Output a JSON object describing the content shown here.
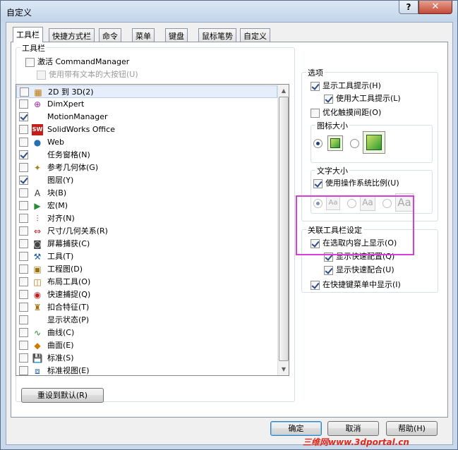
{
  "window": {
    "title": "自定义",
    "help_label": "?",
    "close_label": "✕"
  },
  "tabs": [
    {
      "label": "工具栏",
      "active": true
    },
    {
      "label": "快捷方式栏"
    },
    {
      "label": "命令"
    },
    {
      "label": "菜单"
    },
    {
      "label": "键盘"
    },
    {
      "label": "鼠标笔势"
    },
    {
      "label": "自定义"
    }
  ],
  "toolbars": {
    "group_title": "工具栏",
    "activate_cm": {
      "label": "激活 CommandManager",
      "checked": false
    },
    "use_large_text": {
      "label": "使用带有文本的大按钮(U)",
      "checked": false,
      "disabled": true
    },
    "items": [
      {
        "label": "2D 到 3D(2)",
        "checked": false,
        "icon": "2d-to-3d-icon",
        "glyph": "▦",
        "color": "#c07a00"
      },
      {
        "label": "DimXpert",
        "checked": false,
        "icon": "dimxpert-icon",
        "glyph": "⊕",
        "color": "#9b2aa0"
      },
      {
        "label": "MotionManager",
        "checked": true,
        "icon": "motionmanager-icon",
        "glyph": "",
        "color": "#000"
      },
      {
        "label": "SolidWorks Office",
        "checked": false,
        "icon": "solidworks-office-icon",
        "glyph": "SW",
        "color": "#c3201a"
      },
      {
        "label": "Web",
        "checked": false,
        "icon": "globe-icon",
        "glyph": "●",
        "color": "#2a6fb5"
      },
      {
        "label": "任务窗格(N)",
        "checked": true,
        "icon": "task-pane-icon",
        "glyph": "",
        "color": "#000"
      },
      {
        "label": "参考几何体(G)",
        "checked": false,
        "icon": "reference-geometry-icon",
        "glyph": "✦",
        "color": "#9a8a20"
      },
      {
        "label": "图层(Y)",
        "checked": true,
        "icon": "layers-icon",
        "glyph": "",
        "color": "#000"
      },
      {
        "label": "块(B)",
        "checked": false,
        "icon": "block-icon",
        "glyph": "A",
        "color": "#333"
      },
      {
        "label": "宏(M)",
        "checked": false,
        "icon": "macro-icon",
        "glyph": "▶",
        "color": "#2a8a3a"
      },
      {
        "label": "对齐(N)",
        "checked": false,
        "icon": "align-icon",
        "glyph": "⫶",
        "color": "#b02020"
      },
      {
        "label": "尺寸/几何关系(R)",
        "checked": false,
        "icon": "dimension-icon",
        "glyph": "⇔",
        "color": "#b02020"
      },
      {
        "label": "屏幕捕获(C)",
        "checked": false,
        "icon": "screen-capture-icon",
        "glyph": "◙",
        "color": "#444"
      },
      {
        "label": "工具(T)",
        "checked": false,
        "icon": "tools-icon",
        "glyph": "⚒",
        "color": "#1a5aa0"
      },
      {
        "label": "工程图(D)",
        "checked": false,
        "icon": "drawing-icon",
        "glyph": "▣",
        "color": "#a07010"
      },
      {
        "label": "布局工具(O)",
        "checked": false,
        "icon": "layout-tools-icon",
        "glyph": "◫",
        "color": "#a07010"
      },
      {
        "label": "快速捕捉(Q)",
        "checked": false,
        "icon": "quick-snap-icon",
        "glyph": "◉",
        "color": "#c02020"
      },
      {
        "label": "扣合特征(T)",
        "checked": false,
        "icon": "fastening-feature-icon",
        "glyph": "♜",
        "color": "#a07010"
      },
      {
        "label": "显示状态(P)",
        "checked": false,
        "icon": "display-state-icon",
        "glyph": "",
        "color": "#000"
      },
      {
        "label": "曲线(C)",
        "checked": false,
        "icon": "curves-icon",
        "glyph": "∿",
        "color": "#2a8a2a"
      },
      {
        "label": "曲面(E)",
        "checked": false,
        "icon": "surfaces-icon",
        "glyph": "◆",
        "color": "#d07a00"
      },
      {
        "label": "标准(S)",
        "checked": false,
        "icon": "standard-icon",
        "glyph": "💾",
        "color": "#1a5aa0"
      },
      {
        "label": "标准视图(E)",
        "checked": false,
        "icon": "standard-views-icon",
        "glyph": "⧈",
        "color": "#1a5aa0"
      }
    ]
  },
  "reset_label": "重设到默认(R)",
  "options": {
    "title": "选项",
    "show_tooltips": {
      "label": "显示工具提示(H)",
      "checked": true
    },
    "large_tooltips": {
      "label": "使用大工具提示(L)",
      "checked": true
    },
    "optimize_touch": {
      "label": "优化触摸间距(O)",
      "checked": false
    },
    "icon_size": {
      "title": "图标大小",
      "selected": "small"
    },
    "text_size": {
      "title": "文字大小",
      "use_os_scale": {
        "label": "使用操作系统比例(U)",
        "checked": true
      },
      "sample": "Aa"
    }
  },
  "context": {
    "title": "关联工具栏设定",
    "show_on_selection": {
      "label": "在选取内容上显示(O)",
      "checked": true
    },
    "show_quick_config": {
      "label": "显示快速配置(Q)",
      "checked": true
    },
    "show_quick_mates": {
      "label": "显示快速配合(U)",
      "checked": true
    },
    "show_in_shortcut": {
      "label": "在快捷键菜单中显示(I)",
      "checked": true
    }
  },
  "footer": {
    "ok": "确定",
    "cancel": "取消",
    "help": "帮助(H)"
  },
  "watermark": "三维网www.3dportal.cn"
}
